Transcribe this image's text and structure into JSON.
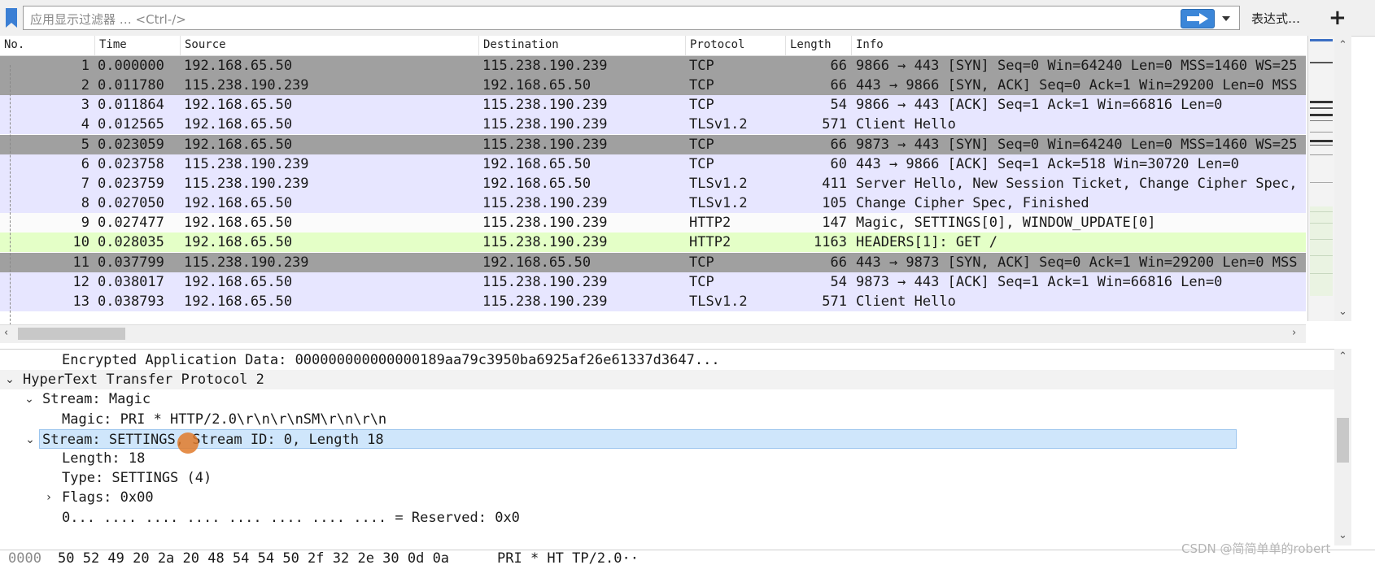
{
  "filter": {
    "placeholder": "应用显示过滤器 … <Ctrl-/>",
    "expression_label": "表达式…",
    "add_label": "+"
  },
  "packet_list": {
    "columns": [
      "No.",
      "Time",
      "Source",
      "Destination",
      "Protocol",
      "Length",
      "Info"
    ],
    "rows": [
      {
        "no": "1",
        "time": "0.000000",
        "src": "192.168.65.50",
        "dst": "115.238.190.239",
        "proto": "TCP",
        "len": "66",
        "info": "9866 → 443 [SYN] Seq=0 Win=64240 Len=0 MSS=1460 WS=25",
        "color": "gray"
      },
      {
        "no": "2",
        "time": "0.011780",
        "src": "115.238.190.239",
        "dst": "192.168.65.50",
        "proto": "TCP",
        "len": "66",
        "info": "443 → 9866 [SYN, ACK] Seq=0 Ack=1 Win=29200 Len=0 MSS",
        "color": "gray"
      },
      {
        "no": "3",
        "time": "0.011864",
        "src": "192.168.65.50",
        "dst": "115.238.190.239",
        "proto": "TCP",
        "len": "54",
        "info": "9866 → 443 [ACK] Seq=1 Ack=1 Win=66816 Len=0",
        "color": "lavender"
      },
      {
        "no": "4",
        "time": "0.012565",
        "src": "192.168.65.50",
        "dst": "115.238.190.239",
        "proto": "TLSv1.2",
        "len": "571",
        "info": "Client Hello",
        "color": "lavender"
      },
      {
        "no": "5",
        "time": "0.023059",
        "src": "192.168.65.50",
        "dst": "115.238.190.239",
        "proto": "TCP",
        "len": "66",
        "info": "9873 → 443 [SYN] Seq=0 Win=64240 Len=0 MSS=1460 WS=25",
        "color": "gray"
      },
      {
        "no": "6",
        "time": "0.023758",
        "src": "115.238.190.239",
        "dst": "192.168.65.50",
        "proto": "TCP",
        "len": "60",
        "info": "443 → 9866 [ACK] Seq=1 Ack=518 Win=30720 Len=0",
        "color": "lavender"
      },
      {
        "no": "7",
        "time": "0.023759",
        "src": "115.238.190.239",
        "dst": "192.168.65.50",
        "proto": "TLSv1.2",
        "len": "411",
        "info": "Server Hello, New Session Ticket, Change Cipher Spec,",
        "color": "lavender"
      },
      {
        "no": "8",
        "time": "0.027050",
        "src": "192.168.65.50",
        "dst": "115.238.190.239",
        "proto": "TLSv1.2",
        "len": "105",
        "info": "Change Cipher Spec, Finished",
        "color": "lavender"
      },
      {
        "no": "9",
        "time": "0.027477",
        "src": "192.168.65.50",
        "dst": "115.238.190.239",
        "proto": "HTTP2",
        "len": "147",
        "info": "Magic, SETTINGS[0], WINDOW_UPDATE[0]",
        "color": "white"
      },
      {
        "no": "10",
        "time": "0.028035",
        "src": "192.168.65.50",
        "dst": "115.238.190.239",
        "proto": "HTTP2",
        "len": "1163",
        "info": "HEADERS[1]: GET /",
        "color": "green"
      },
      {
        "no": "11",
        "time": "0.037799",
        "src": "115.238.190.239",
        "dst": "192.168.65.50",
        "proto": "TCP",
        "len": "66",
        "info": "443 → 9873 [SYN, ACK] Seq=0 Ack=1 Win=29200 Len=0 MSS",
        "color": "gray"
      },
      {
        "no": "12",
        "time": "0.038017",
        "src": "192.168.65.50",
        "dst": "115.238.190.239",
        "proto": "TCP",
        "len": "54",
        "info": "9873 → 443 [ACK] Seq=1 Ack=1 Win=66816 Len=0",
        "color": "lavender"
      },
      {
        "no": "13",
        "time": "0.038793",
        "src": "192.168.65.50",
        "dst": "115.238.190.239",
        "proto": "TLSv1.2",
        "len": "571",
        "info": "Client Hello",
        "color": "lavender"
      }
    ]
  },
  "details": [
    {
      "text": "Encrypted Application Data: 000000000000000189aa79c3950ba6925af26e61337d3647...",
      "level": 3,
      "expander": "none",
      "state": "normal"
    },
    {
      "text": "HyperText Transfer Protocol 2",
      "level": 1,
      "expander": "expanded",
      "state": "hover"
    },
    {
      "text": "Stream: Magic",
      "level": 2,
      "expander": "expanded",
      "state": "normal"
    },
    {
      "text": "Magic: PRI * HTTP/2.0\\r\\n\\r\\nSM\\r\\n\\r\\n",
      "level": 3,
      "expander": "none",
      "state": "normal"
    },
    {
      "text": "Stream: SETTINGS, Stream ID: 0, Length 18",
      "level": 2,
      "expander": "expanded",
      "state": "selected"
    },
    {
      "text": "Length: 18",
      "level": 3,
      "expander": "none",
      "state": "normal"
    },
    {
      "text": "Type: SETTINGS (4)",
      "level": 3,
      "expander": "none",
      "state": "normal"
    },
    {
      "text": "Flags: 0x00",
      "level": 3,
      "expander": "collapsed",
      "state": "normal"
    },
    {
      "text": "0... .... .... .... .... .... .... .... = Reserved: 0x0",
      "level": 3,
      "expander": "none",
      "state": "normal"
    }
  ],
  "bytes": {
    "offset": "0000",
    "hex": "50 52 49 20 2a 20 48 54  54 50 2f 32 2e 30 0d 0a",
    "ascii": "PRI * HT TP/2.0··"
  },
  "watermark": "CSDN @简简单单的robert",
  "colors": {
    "gray": "#a0a0a0",
    "lavender": "#e7e6ff",
    "white": "#fbfbfb",
    "green": "#e4ffc7",
    "selected": "#cfe6fb",
    "apply_button": "#3b86d8"
  },
  "icons": [
    "bookmark-icon",
    "apply-arrow-icon",
    "dropdown-icon",
    "plus-icon",
    "expanded-chevron-icon",
    "collapsed-chevron-icon",
    "scroll-arrow-icon"
  ]
}
